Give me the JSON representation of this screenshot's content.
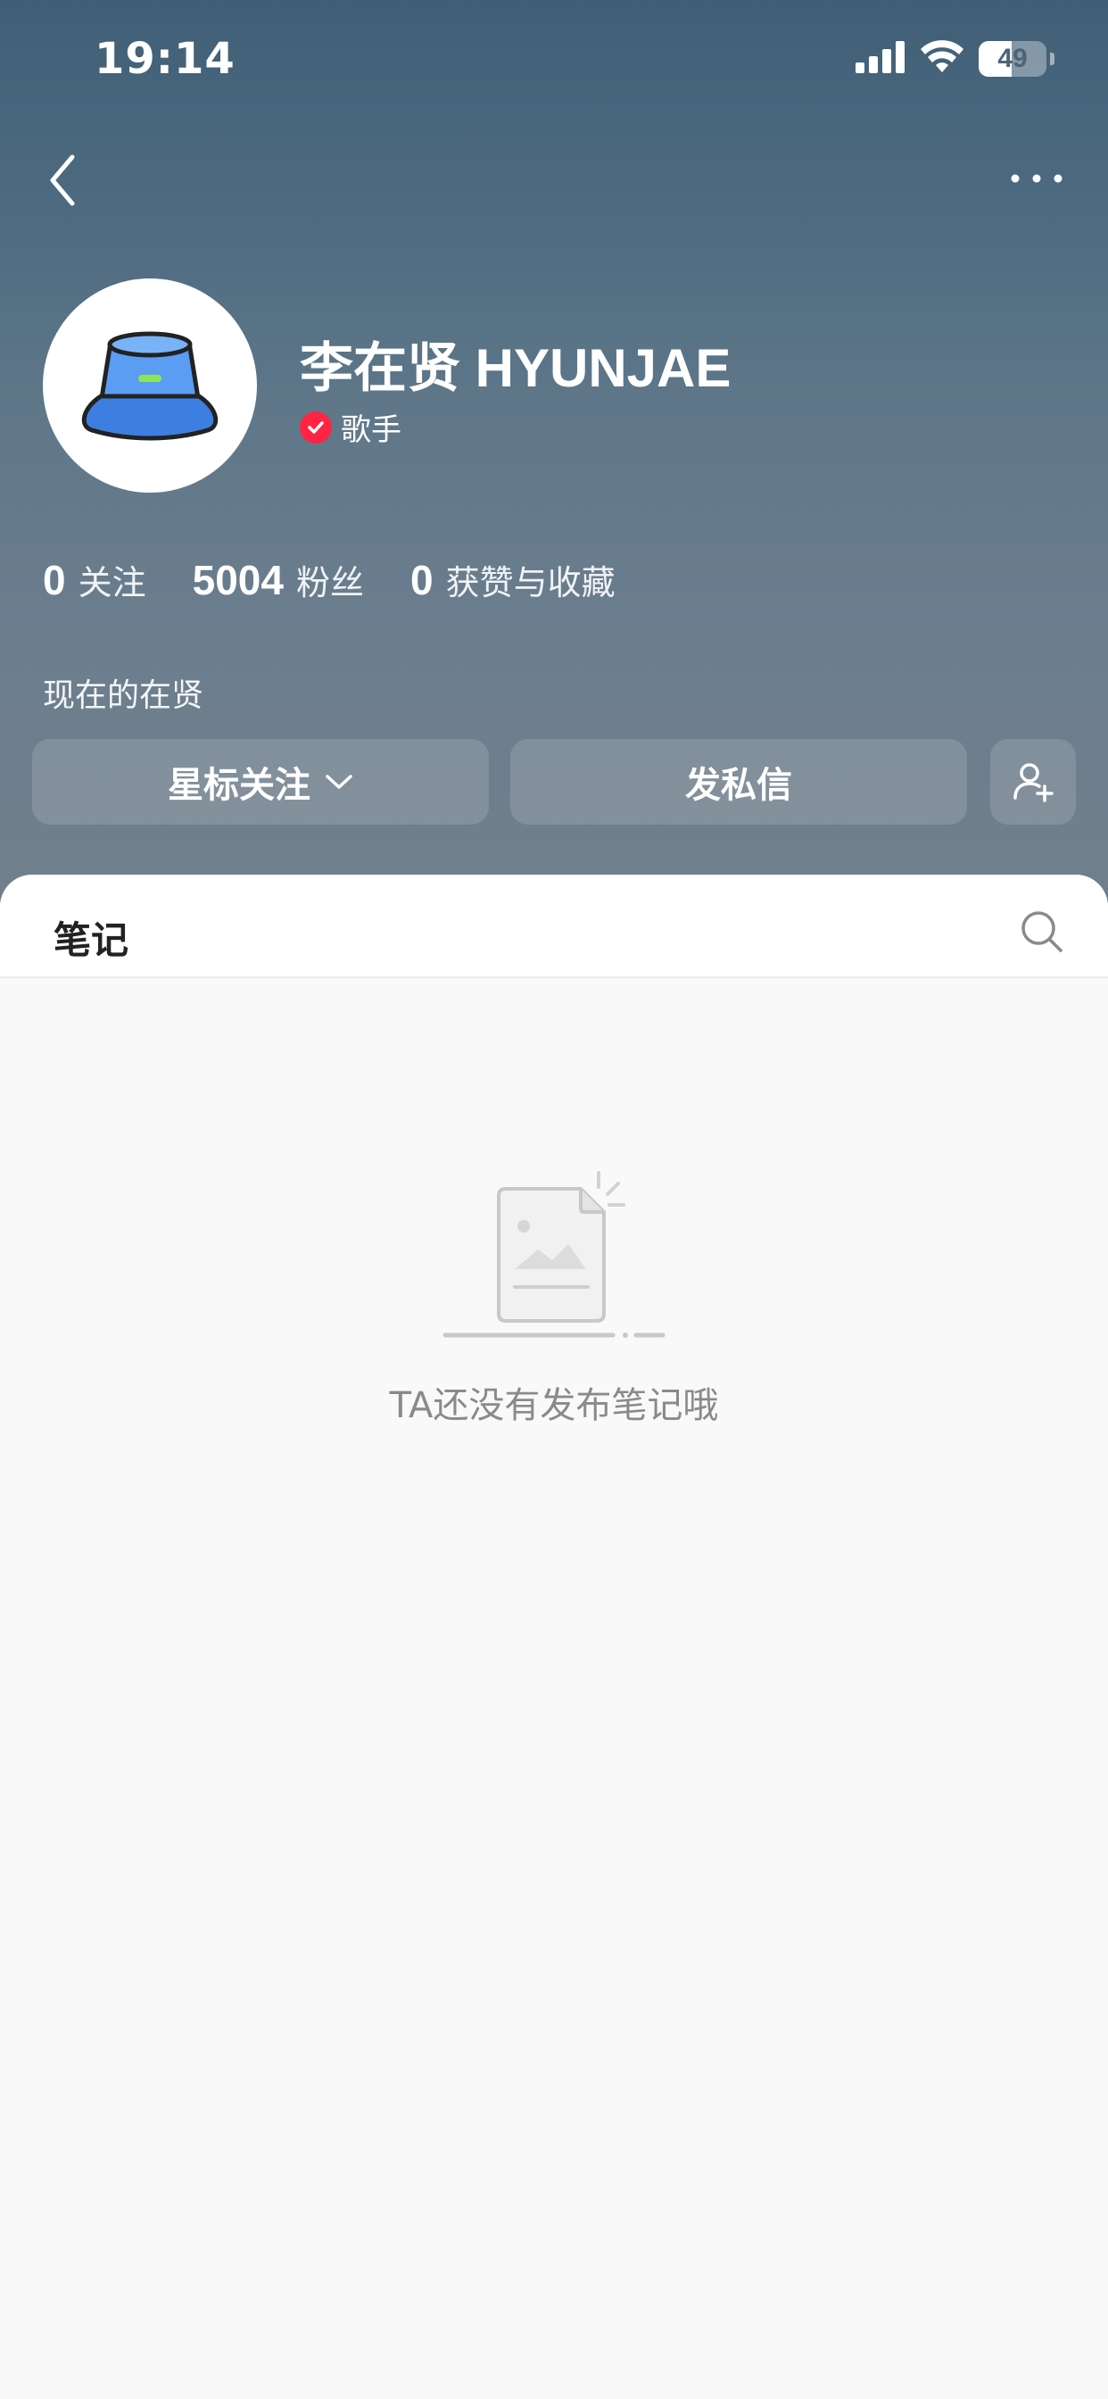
{
  "status_bar": {
    "time": "19:14",
    "battery": "49",
    "battery_level": 0.49
  },
  "nav": {
    "back_icon": "chevron-left-icon",
    "more_icon": "more-horizontal-icon"
  },
  "profile": {
    "name": "李在贤 HYUNJAE",
    "verify_label": "歌手",
    "bio": "现在的在贤",
    "stats": [
      {
        "num": "0",
        "label": "关注"
      },
      {
        "num": "5004",
        "label": "粉丝"
      },
      {
        "num": "0",
        "label": "获赞与收藏"
      }
    ]
  },
  "actions": {
    "star_follow": "星标关注",
    "message": "发私信"
  },
  "tabs": {
    "notes": "笔记"
  },
  "empty_state": {
    "text": "TA还没有发布笔记哦"
  },
  "colors": {
    "header_top": "#405f76",
    "header_bottom": "#717f8b",
    "verify_badge": "#ff2442",
    "background": "#f9f9f9"
  }
}
